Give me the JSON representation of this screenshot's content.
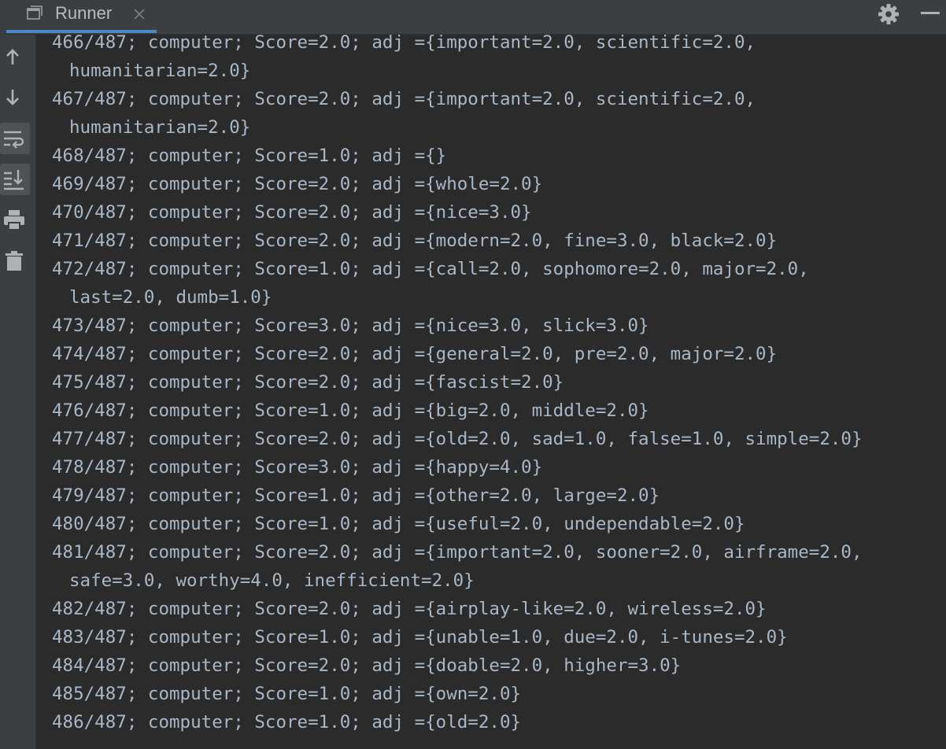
{
  "tab": {
    "title": "Runner"
  },
  "icons": {
    "tab": "console-window-icon",
    "close": "close-icon",
    "settings": "gear-icon",
    "minimize": "minimize-icon"
  },
  "toolbar": [
    {
      "name": "up-arrow-icon",
      "label": "Up the stack trace"
    },
    {
      "name": "down-arrow-icon",
      "label": "Down the stack trace"
    },
    {
      "name": "soft-wrap-icon",
      "label": "Soft-wrap",
      "active": true
    },
    {
      "name": "scroll-to-end-icon",
      "label": "Scroll to end",
      "active": true
    },
    {
      "name": "print-icon",
      "label": "Print"
    },
    {
      "name": "trash-icon",
      "label": "Clear all"
    }
  ],
  "colors": {
    "background": "#2b2b2b",
    "panel": "#3c3f41",
    "text": "#a9b7c6",
    "accent": "#4a88c7"
  },
  "console": {
    "lines": [
      "466/487; computer; Score=2.0; adj ={important=2.0, scientific=2.0,",
      "humanitarian=2.0}",
      "467/487; computer; Score=2.0; adj ={important=2.0, scientific=2.0,",
      "humanitarian=2.0}",
      "468/487; computer; Score=1.0; adj ={}",
      "469/487; computer; Score=2.0; adj ={whole=2.0}",
      "470/487; computer; Score=2.0; adj ={nice=3.0}",
      "471/487; computer; Score=2.0; adj ={modern=2.0, fine=3.0, black=2.0}",
      "472/487; computer; Score=1.0; adj ={call=2.0, sophomore=2.0, major=2.0,",
      "last=2.0, dumb=1.0}",
      "473/487; computer; Score=3.0; adj ={nice=3.0, slick=3.0}",
      "474/487; computer; Score=2.0; adj ={general=2.0, pre=2.0, major=2.0}",
      "475/487; computer; Score=2.0; adj ={fascist=2.0}",
      "476/487; computer; Score=1.0; adj ={big=2.0, middle=2.0}",
      "477/487; computer; Score=2.0; adj ={old=2.0, sad=1.0, false=1.0, simple=2.0}",
      "478/487; computer; Score=3.0; adj ={happy=4.0}",
      "479/487; computer; Score=1.0; adj ={other=2.0, large=2.0}",
      "480/487; computer; Score=1.0; adj ={useful=2.0, undependable=2.0}",
      "481/487; computer; Score=2.0; adj ={important=2.0, sooner=2.0, airframe=2.0,",
      "safe=3.0, worthy=4.0, inefficient=2.0}",
      "482/487; computer; Score=2.0; adj ={airplay-like=2.0, wireless=2.0}",
      "483/487; computer; Score=1.0; adj ={unable=1.0, due=2.0, i-tunes=2.0}",
      "484/487; computer; Score=2.0; adj ={doable=2.0, higher=3.0}",
      "485/487; computer; Score=1.0; adj ={own=2.0}",
      "486/487; computer; Score=1.0; adj ={old=2.0}"
    ]
  }
}
